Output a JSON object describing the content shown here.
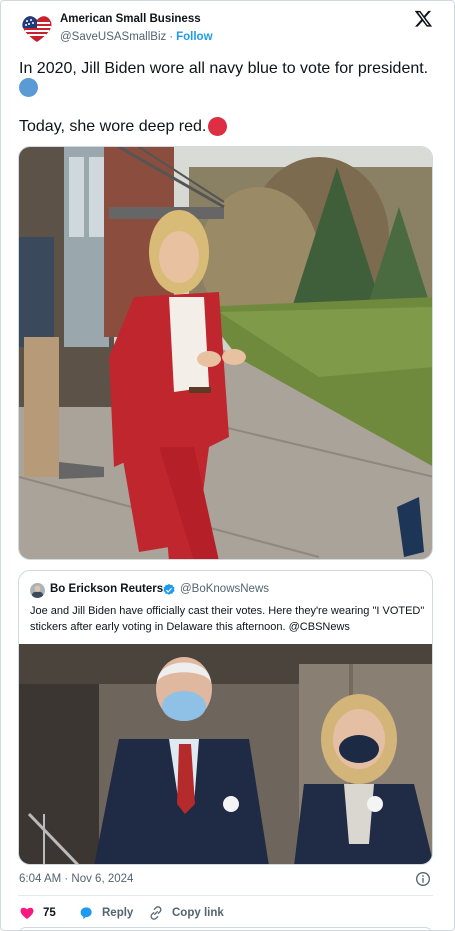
{
  "author": {
    "name": "American Small Business",
    "handle": "@SaveUSASmallBiz",
    "separator": "·",
    "follow_label": "Follow",
    "avatar_icon": "us-flag-heart-avatar"
  },
  "tweet": {
    "line1": "In 2020, Jill Biden wore all navy blue to vote for president.",
    "line2": "Today, she wore deep red.",
    "emoji1": "blue-circle-emoji",
    "emoji2": "red-circle-emoji",
    "image_description_icon": "photo-woman-red-suit"
  },
  "quote": {
    "name": "Bo Erickson Reuters",
    "handle": "@BoKnowsNews",
    "verified_icon": "verified-badge-icon",
    "text": "Joe and Jill Biden have officially cast their votes. Here they're wearing \"I VOTED\" stickers after early voting in Delaware this afternoon. @CBSNews",
    "image_icon": "photo-couple-masks"
  },
  "footer": {
    "timestamp": "6:04 AM · Nov 6, 2024",
    "likes": "75",
    "reply_label": "Reply",
    "copy_label": "Copy link"
  },
  "colors": {
    "accent": "#1d9bf0",
    "like": "#f91880",
    "text": "#0f1419",
    "muted": "#536471"
  }
}
